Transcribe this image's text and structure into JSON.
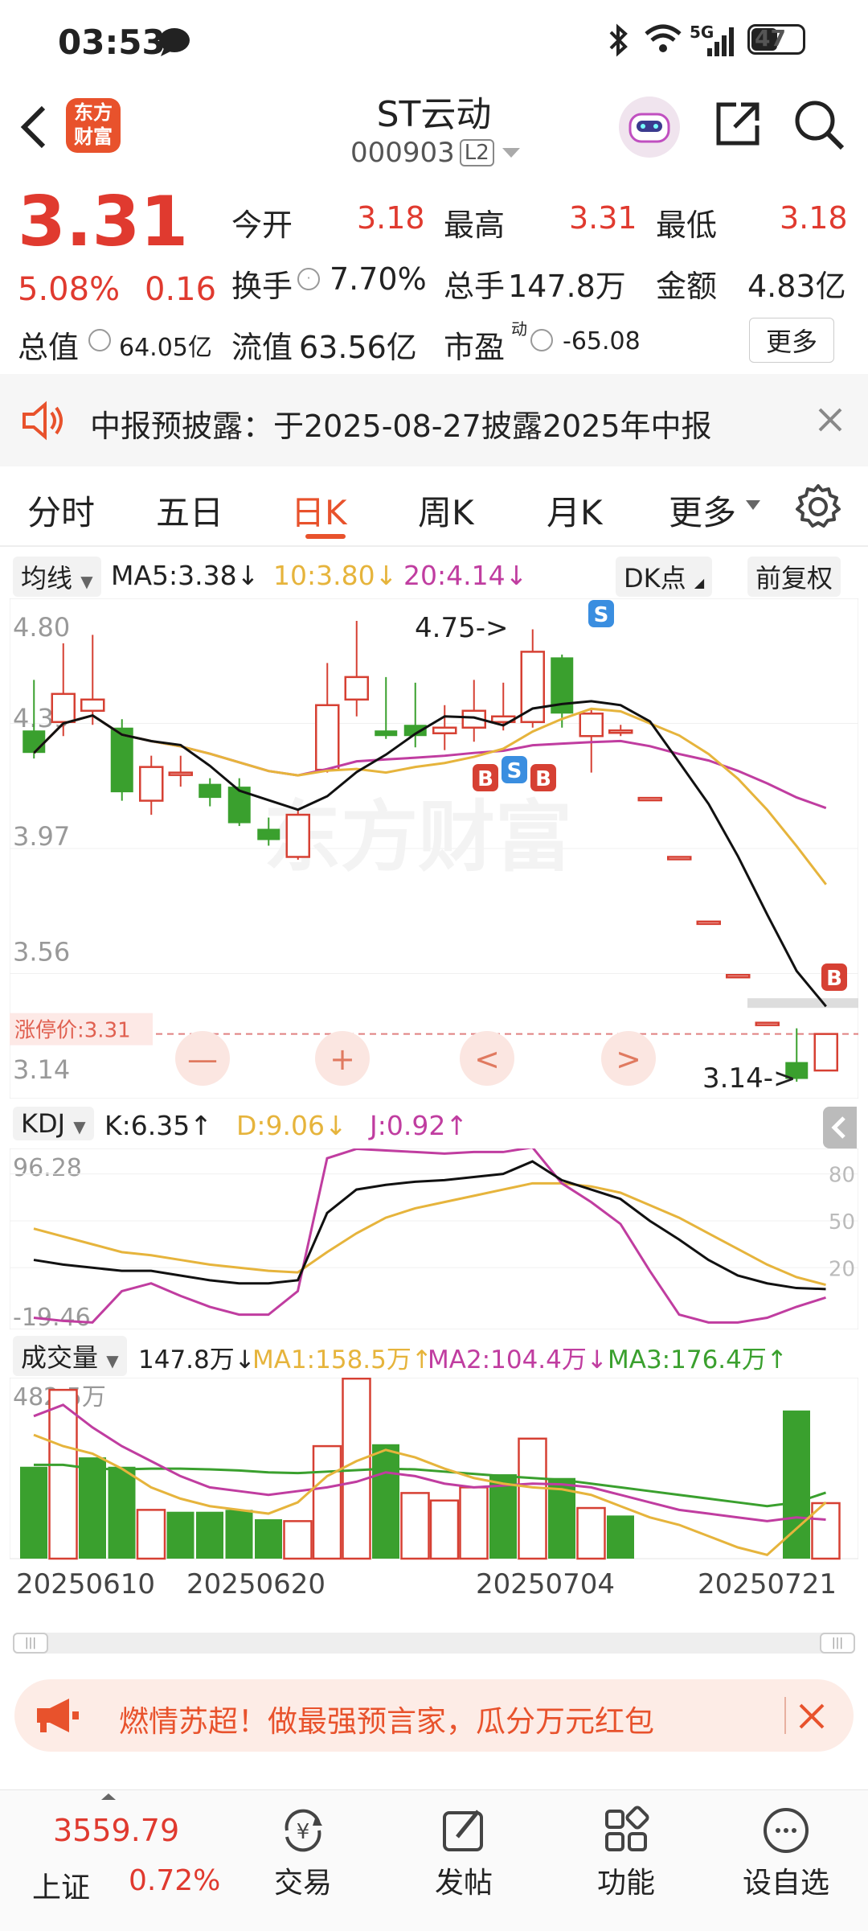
{
  "status": {
    "time": "03:53",
    "battery": "47",
    "network": "5G",
    "icons": [
      "chat-bubble-icon",
      "bluetooth-icon",
      "wifi-icon",
      "signal-icon",
      "battery-icon"
    ]
  },
  "header": {
    "stock_name": "ST云动",
    "stock_code": "000903",
    "level": "L2",
    "logo_text": "东方财富"
  },
  "quote": {
    "price": "3.31",
    "change_pct": "5.08%",
    "change": "0.16",
    "open_label": "今开",
    "open": "3.18",
    "high_label": "最高",
    "high": "3.31",
    "low_label": "最低",
    "low": "3.18",
    "turnover_label": "换手",
    "turnover": "7.70%",
    "volume_label": "总手",
    "volume": "147.8万",
    "amount_label": "金额",
    "amount": "4.83亿",
    "total_cap_label": "总值",
    "total_cap": "64.05亿",
    "float_cap_label": "流值",
    "float_cap": "63.56亿",
    "pe_label": "市盈",
    "pe_sup": "动",
    "pe": "-65.08",
    "more": "更多"
  },
  "notice": {
    "text": "中报预披露：于2025-08-27披露2025年中报"
  },
  "tabs": [
    "分时",
    "五日",
    "日K",
    "周K",
    "月K",
    "更多"
  ],
  "tab_active": 2,
  "ma": {
    "selector": "均线",
    "ma5": "MA5:3.38↓",
    "ma10": "10:3.80↓",
    "ma20": "20:4.14↓",
    "dk": "DK点",
    "fq": "前复权"
  },
  "kchart": {
    "y_labels": [
      "4.80",
      "4.39",
      "3.97",
      "3.56",
      "3.14"
    ],
    "limit_label": "涨停价:3.31",
    "high_mark": "4.75->",
    "low_mark": "3.14->",
    "watermark": "东方财富",
    "markers": [
      "B",
      "S",
      "B",
      "S",
      "B"
    ],
    "zoom_controls": [
      "—",
      "+",
      "<",
      ">"
    ],
    "candles": [
      {
        "o": 4.39,
        "c": 4.31,
        "h": 4.57,
        "l": 4.29
      },
      {
        "o": 4.42,
        "c": 4.52,
        "h": 4.7,
        "l": 4.37
      },
      {
        "o": 4.46,
        "c": 4.5,
        "h": 4.73,
        "l": 4.41
      },
      {
        "o": 4.4,
        "c": 4.17,
        "h": 4.43,
        "l": 4.14
      },
      {
        "o": 4.14,
        "c": 4.26,
        "h": 4.3,
        "l": 4.09
      },
      {
        "o": 4.24,
        "c": 4.24,
        "h": 4.3,
        "l": 4.19
      },
      {
        "o": 4.2,
        "c": 4.15,
        "h": 4.22,
        "l": 4.12
      },
      {
        "o": 4.19,
        "c": 4.06,
        "h": 4.22,
        "l": 4.05
      },
      {
        "o": 4.04,
        "c": 4.0,
        "h": 4.08,
        "l": 3.98
      },
      {
        "o": 3.94,
        "c": 4.09,
        "h": 4.11,
        "l": 3.93
      },
      {
        "o": 4.25,
        "c": 4.48,
        "h": 4.63,
        "l": 4.24
      },
      {
        "o": 4.5,
        "c": 4.58,
        "h": 4.78,
        "l": 4.44
      },
      {
        "o": 4.39,
        "c": 4.37,
        "h": 4.58,
        "l": 4.36
      },
      {
        "o": 4.41,
        "c": 4.37,
        "h": 4.56,
        "l": 4.33
      },
      {
        "o": 4.38,
        "c": 4.4,
        "h": 4.48,
        "l": 4.32
      },
      {
        "o": 4.4,
        "c": 4.46,
        "h": 4.57,
        "l": 4.35
      },
      {
        "o": 4.42,
        "c": 4.44,
        "h": 4.56,
        "l": 4.39
      },
      {
        "o": 4.42,
        "c": 4.67,
        "h": 4.75,
        "l": 4.4
      },
      {
        "o": 4.65,
        "c": 4.45,
        "h": 4.66,
        "l": 4.4
      },
      {
        "o": 4.37,
        "c": 4.45,
        "h": 4.47,
        "l": 4.24
      },
      {
        "o": 4.39,
        "c": 4.39,
        "h": 4.41,
        "l": 4.37
      },
      {
        "o": 4.15,
        "c": 4.15,
        "h": 4.15,
        "l": 4.15
      },
      {
        "o": 3.94,
        "c": 3.94,
        "h": 3.94,
        "l": 3.94
      },
      {
        "o": 3.71,
        "c": 3.71,
        "h": 3.71,
        "l": 3.71
      },
      {
        "o": 3.52,
        "c": 3.52,
        "h": 3.52,
        "l": 3.52
      },
      {
        "o": 3.35,
        "c": 3.35,
        "h": 3.35,
        "l": 3.35
      },
      {
        "o": 3.21,
        "c": 3.15,
        "h": 3.33,
        "l": 3.14
      },
      {
        "o": 3.18,
        "c": 3.31,
        "h": 3.31,
        "l": 3.18
      }
    ]
  },
  "kdj": {
    "selector": "KDJ",
    "k": "K:6.35↑",
    "d": "D:9.06↓",
    "j": "J:0.92↑",
    "top": "96.28",
    "bottom": "-19.46",
    "levels": [
      "80",
      "50",
      "20"
    ]
  },
  "vol": {
    "selector": "成交量",
    "value": "147.8万↓",
    "ma1": "MA1:158.5万↑",
    "ma2": "MA2:104.4万↓",
    "ma3": "MA3:176.4万↑",
    "max_label": "482.5万",
    "dates": [
      "20250610",
      "20250620",
      "20250704",
      "20250721"
    ],
    "bars": [
      {
        "v": 245,
        "up": false
      },
      {
        "v": 450,
        "up": true
      },
      {
        "v": 270,
        "up": false
      },
      {
        "v": 245,
        "up": false
      },
      {
        "v": 130,
        "up": true
      },
      {
        "v": 125,
        "up": false
      },
      {
        "v": 125,
        "up": false
      },
      {
        "v": 130,
        "up": false
      },
      {
        "v": 105,
        "up": false
      },
      {
        "v": 100,
        "up": true
      },
      {
        "v": 300,
        "up": true
      },
      {
        "v": 480,
        "up": true
      },
      {
        "v": 305,
        "up": false
      },
      {
        "v": 175,
        "up": true
      },
      {
        "v": 155,
        "up": true
      },
      {
        "v": 190,
        "up": true
      },
      {
        "v": 225,
        "up": false
      },
      {
        "v": 320,
        "up": true
      },
      {
        "v": 215,
        "up": false
      },
      {
        "v": 135,
        "up": true
      },
      {
        "v": 115,
        "up": false
      },
      {
        "v": 0,
        "up": false
      },
      {
        "v": 0,
        "up": false
      },
      {
        "v": 0,
        "up": false
      },
      {
        "v": 0,
        "up": false
      },
      {
        "v": 0,
        "up": false
      },
      {
        "v": 395,
        "up": false
      },
      {
        "v": 148,
        "up": true
      }
    ]
  },
  "banner": {
    "text": "燃情苏超！做最强预言家，瓜分万元红包"
  },
  "bottom": {
    "index_value": "3559.79",
    "index_name": "上证",
    "index_change": "0.72%",
    "items": [
      {
        "label": "交易",
        "icon": "trade-yen-icon"
      },
      {
        "label": "发帖",
        "icon": "edit-post-icon"
      },
      {
        "label": "功能",
        "icon": "grid-functions-icon"
      },
      {
        "label": "设自选",
        "icon": "add-watchlist-icon"
      }
    ]
  }
}
